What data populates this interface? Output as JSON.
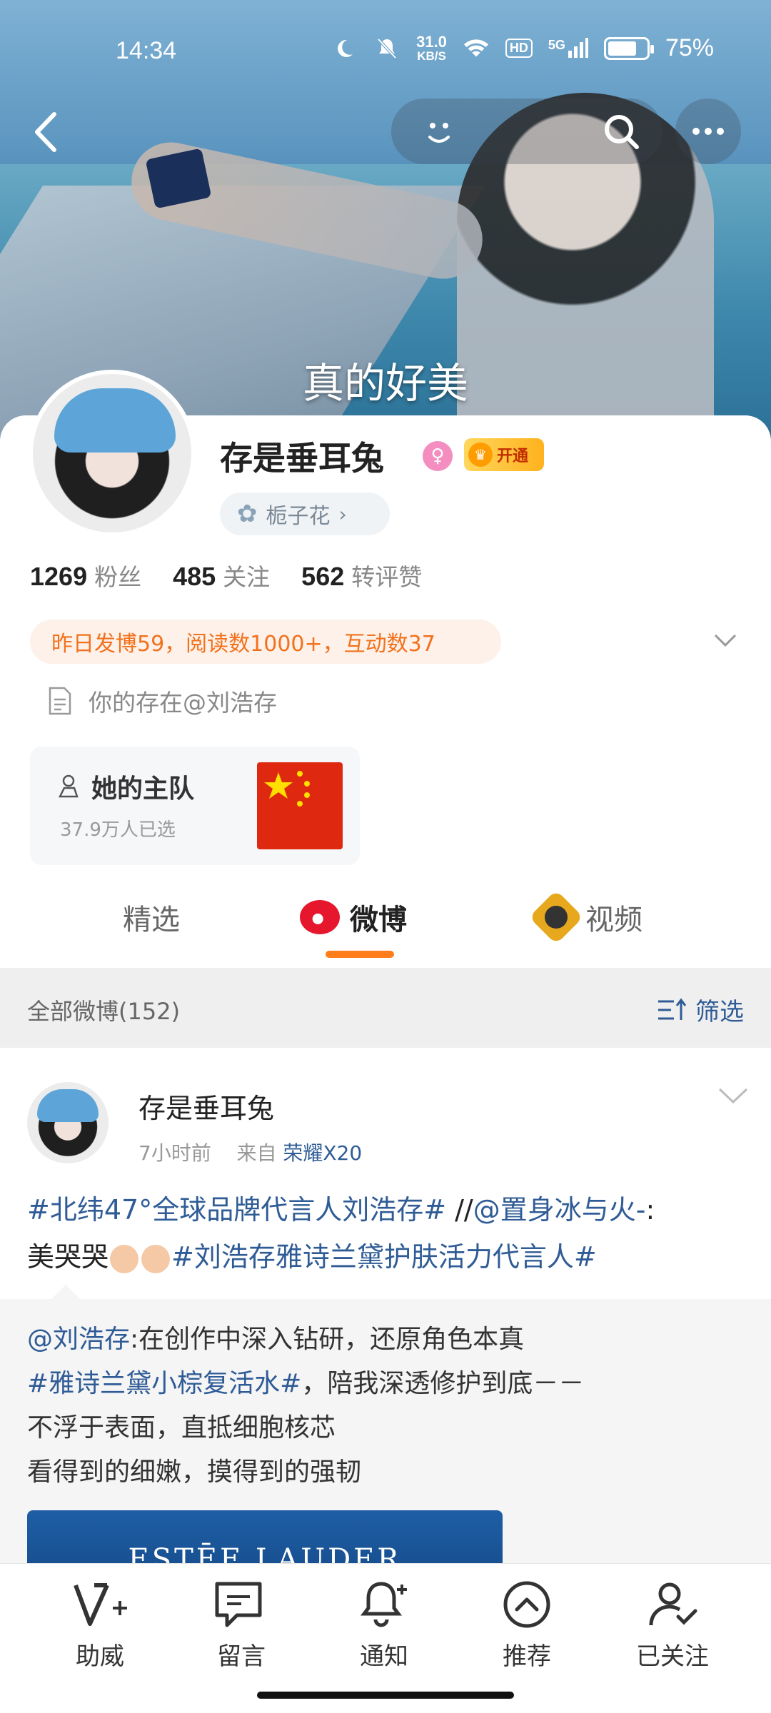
{
  "status_bar": {
    "time": "14:34",
    "speed_value": "31.0",
    "speed_unit": "KB/S",
    "hd": "HD",
    "network": "5G",
    "battery": "75%",
    "battery_level": 0.75
  },
  "banner": {
    "subtitle": "真的好美"
  },
  "profile": {
    "nickname": "存是垂耳兔",
    "vip_label": "开通",
    "tag_label": "栀子花",
    "stats": [
      {
        "num": "1269",
        "label": "粉丝"
      },
      {
        "num": "485",
        "label": "关注"
      },
      {
        "num": "562",
        "label": "转评赞"
      }
    ],
    "daily": "昨日发博59，阅读数1000+，互动数37",
    "bio": "你的存在@刘浩存",
    "team_title": "她的主队",
    "team_sub": "37.9万人已选"
  },
  "tabs": [
    {
      "label": "精选"
    },
    {
      "label": "微博"
    },
    {
      "label": "视频"
    }
  ],
  "filter": {
    "all_label": "全部微博(152)",
    "filter_label": "筛选"
  },
  "post": {
    "name": "存是垂耳兔",
    "time": "7小时前",
    "from_prefix": "来自",
    "device": "荣耀X20",
    "tag1": "#北纬47°全球品牌代言人刘浩存#",
    "mid1": " //",
    "mention1": "@置身冰与火-",
    "mid2": ":",
    "text2": "美哭哭",
    "tag2": "#刘浩存雅诗兰黛护肤活力代言人#"
  },
  "repost": {
    "mention": "@刘浩存",
    "line1_rest": ":在创作中深入钻研，还原角色本真",
    "tag": "#雅诗兰黛小棕复活水#",
    "line2_rest": "，陪我深透修护到底－－",
    "line3": "不浮于表面，直抵细胞核芯",
    "line4": "看得到的细嫩，摸得到的强韧",
    "image_brand": "ESTĒE LAUDER"
  },
  "bottom_bar": [
    {
      "label": "助威",
      "icon": "cheer-icon"
    },
    {
      "label": "留言",
      "icon": "message-icon"
    },
    {
      "label": "通知",
      "icon": "bell-icon"
    },
    {
      "label": "推荐",
      "icon": "recommend-icon"
    },
    {
      "label": "已关注",
      "icon": "followed-icon"
    }
  ],
  "colors": {
    "accent_orange": "#ff7d1a",
    "link_blue": "#2f5c96",
    "daily_text": "#f2711c"
  }
}
